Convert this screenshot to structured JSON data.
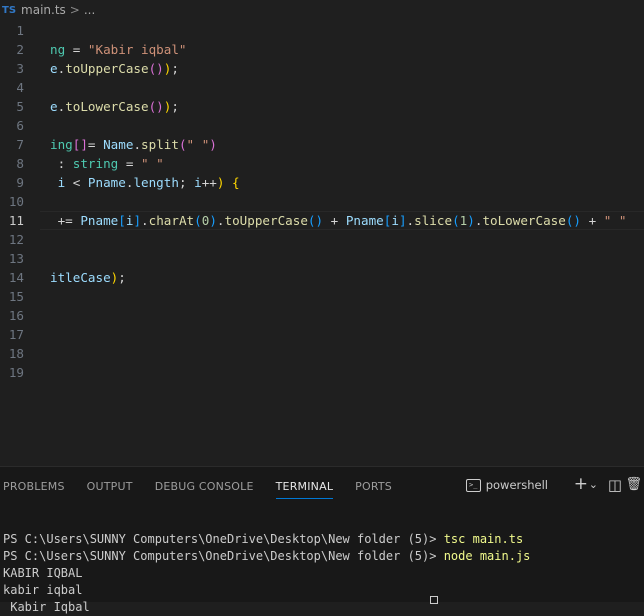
{
  "breadcrumb": {
    "badge": "TS",
    "file": "main.ts",
    "sep": ">",
    "more": "..."
  },
  "editor": {
    "lines": [
      {
        "n": "1",
        "tokens": []
      },
      {
        "n": "2",
        "tokens": [
          {
            "t": "ng",
            "c": "t-type"
          },
          {
            "t": " = ",
            "c": "t-op"
          },
          {
            "t": "\"Kabir iqbal\"",
            "c": "t-str"
          }
        ]
      },
      {
        "n": "3",
        "tokens": [
          {
            "t": "e",
            "c": "t-var"
          },
          {
            "t": ".",
            "c": "t-op"
          },
          {
            "t": "toUpperCase",
            "c": "t-fn"
          },
          {
            "t": "()",
            "c": "t-b2"
          },
          {
            "t": ")",
            "c": "t-b1"
          },
          {
            "t": ";",
            "c": "t-op"
          }
        ]
      },
      {
        "n": "4",
        "tokens": []
      },
      {
        "n": "5",
        "tokens": [
          {
            "t": "e",
            "c": "t-var"
          },
          {
            "t": ".",
            "c": "t-op"
          },
          {
            "t": "toLowerCase",
            "c": "t-fn"
          },
          {
            "t": "()",
            "c": "t-b2"
          },
          {
            "t": ")",
            "c": "t-b1"
          },
          {
            "t": ";",
            "c": "t-op"
          }
        ]
      },
      {
        "n": "6",
        "tokens": []
      },
      {
        "n": "7",
        "tokens": [
          {
            "t": "ing",
            "c": "t-type"
          },
          {
            "t": "[]",
            "c": "t-b2"
          },
          {
            "t": "= ",
            "c": "t-op"
          },
          {
            "t": "Name",
            "c": "t-var"
          },
          {
            "t": ".",
            "c": "t-op"
          },
          {
            "t": "split",
            "c": "t-fn"
          },
          {
            "t": "(",
            "c": "t-b2"
          },
          {
            "t": "\" \"",
            "c": "t-str"
          },
          {
            "t": ")",
            "c": "t-b2"
          }
        ]
      },
      {
        "n": "8",
        "tokens": [
          {
            "t": " : ",
            "c": "t-op"
          },
          {
            "t": "string",
            "c": "t-type"
          },
          {
            "t": " = ",
            "c": "t-op"
          },
          {
            "t": "\" \"",
            "c": "t-str"
          }
        ]
      },
      {
        "n": "9",
        "tokens": [
          {
            "t": " i",
            "c": "t-var"
          },
          {
            "t": " < ",
            "c": "t-op"
          },
          {
            "t": "Pname",
            "c": "t-var"
          },
          {
            "t": ".",
            "c": "t-op"
          },
          {
            "t": "length",
            "c": "t-var"
          },
          {
            "t": "; ",
            "c": "t-op"
          },
          {
            "t": "i",
            "c": "t-var"
          },
          {
            "t": "++",
            "c": "t-op"
          },
          {
            "t": ") ",
            "c": "t-b1"
          },
          {
            "t": "{",
            "c": "t-b1"
          }
        ]
      },
      {
        "n": "10",
        "tokens": []
      },
      {
        "n": "11",
        "active": true,
        "tokens": [
          {
            "t": " += ",
            "c": "t-op"
          },
          {
            "t": "Pname",
            "c": "t-var"
          },
          {
            "t": "[",
            "c": "t-b3"
          },
          {
            "t": "i",
            "c": "t-var"
          },
          {
            "t": "]",
            "c": "t-b3"
          },
          {
            "t": ".",
            "c": "t-op"
          },
          {
            "t": "charAt",
            "c": "t-fn"
          },
          {
            "t": "(",
            "c": "t-b3"
          },
          {
            "t": "0",
            "c": "t-num"
          },
          {
            "t": ")",
            "c": "t-b3"
          },
          {
            "t": ".",
            "c": "t-op"
          },
          {
            "t": "toUpperCase",
            "c": "t-fn"
          },
          {
            "t": "()",
            "c": "t-b3"
          },
          {
            "t": " + ",
            "c": "t-op"
          },
          {
            "t": "Pname",
            "c": "t-var"
          },
          {
            "t": "[",
            "c": "t-b3"
          },
          {
            "t": "i",
            "c": "t-var"
          },
          {
            "t": "]",
            "c": "t-b3"
          },
          {
            "t": ".",
            "c": "t-op"
          },
          {
            "t": "slice",
            "c": "t-fn"
          },
          {
            "t": "(",
            "c": "t-b3"
          },
          {
            "t": "1",
            "c": "t-num"
          },
          {
            "t": ")",
            "c": "t-b3"
          },
          {
            "t": ".",
            "c": "t-op"
          },
          {
            "t": "toLowerCase",
            "c": "t-fn"
          },
          {
            "t": "()",
            "c": "t-b3"
          },
          {
            "t": " + ",
            "c": "t-op"
          },
          {
            "t": "\" \"",
            "c": "t-str"
          }
        ]
      },
      {
        "n": "12",
        "tokens": []
      },
      {
        "n": "13",
        "tokens": []
      },
      {
        "n": "14",
        "tokens": [
          {
            "t": "itleCase",
            "c": "t-var"
          },
          {
            "t": ")",
            "c": "t-b1"
          },
          {
            "t": ";",
            "c": "t-op"
          }
        ]
      },
      {
        "n": "15",
        "tokens": []
      },
      {
        "n": "16",
        "tokens": []
      },
      {
        "n": "17",
        "tokens": []
      },
      {
        "n": "18",
        "tokens": []
      },
      {
        "n": "19",
        "tokens": []
      }
    ]
  },
  "panel": {
    "tabs": [
      {
        "label": "PROBLEMS"
      },
      {
        "label": "OUTPUT"
      },
      {
        "label": "DEBUG CONSOLE"
      },
      {
        "label": "TERMINAL",
        "active": true
      },
      {
        "label": "PORTS"
      }
    ],
    "shell": "powershell",
    "add_glyph": "+",
    "dropdown_glyph": "⌄",
    "split_glyph": "◫",
    "trash_glyph": "🗑",
    "terminal": {
      "line1_prompt": "PS C:\\Users\\SUNNY Computers\\OneDrive\\Desktop\\New folder (5)> ",
      "line1_cmd": "tsc main.ts",
      "line2_prompt": "PS C:\\Users\\SUNNY Computers\\OneDrive\\Desktop\\New folder (5)> ",
      "line2_cmd": "node main.js",
      "out1": "KABIR IQBAL",
      "out2": "kabir iqbal",
      "out3": " Kabir Iqbal"
    }
  }
}
